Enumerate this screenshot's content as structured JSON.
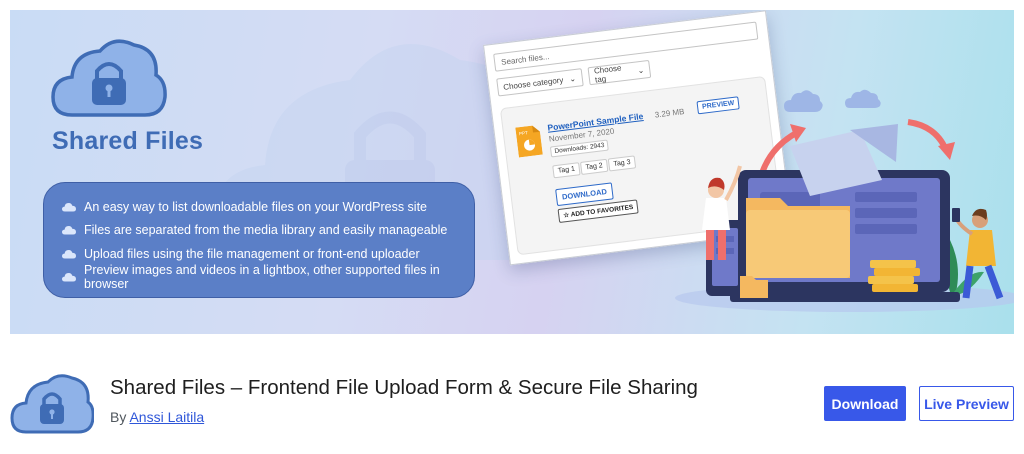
{
  "banner": {
    "brand_title": "Shared Files",
    "features": [
      "An easy way to list downloadable files on your WordPress site",
      "Files are separated from the media library and easily manageable",
      "Upload files using the file management or front-end uploader",
      "Preview images and videos in a lightbox, other supported files in browser"
    ],
    "mock": {
      "search_placeholder": "Search files...",
      "category_select": "Choose category",
      "tag_select": "Choose tag",
      "file_name": "PowerPoint Sample File",
      "file_size": "3.29 MB",
      "preview_label": "PREVIEW",
      "file_date": "November 7, 2020",
      "downloads": "Downloads: 2943",
      "tags": [
        "Tag 1",
        "Tag 2",
        "Tag 3"
      ],
      "download_label": "DOWNLOAD",
      "favorites_label": "☆ ADD TO FAVORITES",
      "file_type": "PPT"
    }
  },
  "plugin": {
    "title": "Shared Files – Frontend File Upload Form & Secure File Sharing",
    "by_label": "By",
    "author": "Anssi Laitila",
    "download_button": "Download",
    "live_preview_button": "Live Preview"
  },
  "colors": {
    "brand_blue": "#3f6cb5",
    "feature_box": "#5b7fc7",
    "wp_accent": "#3858e9"
  },
  "icons": {
    "logo": "cloud-lock-icon",
    "feature_bullet": "cloud-icon",
    "file": "ppt-file-icon"
  }
}
